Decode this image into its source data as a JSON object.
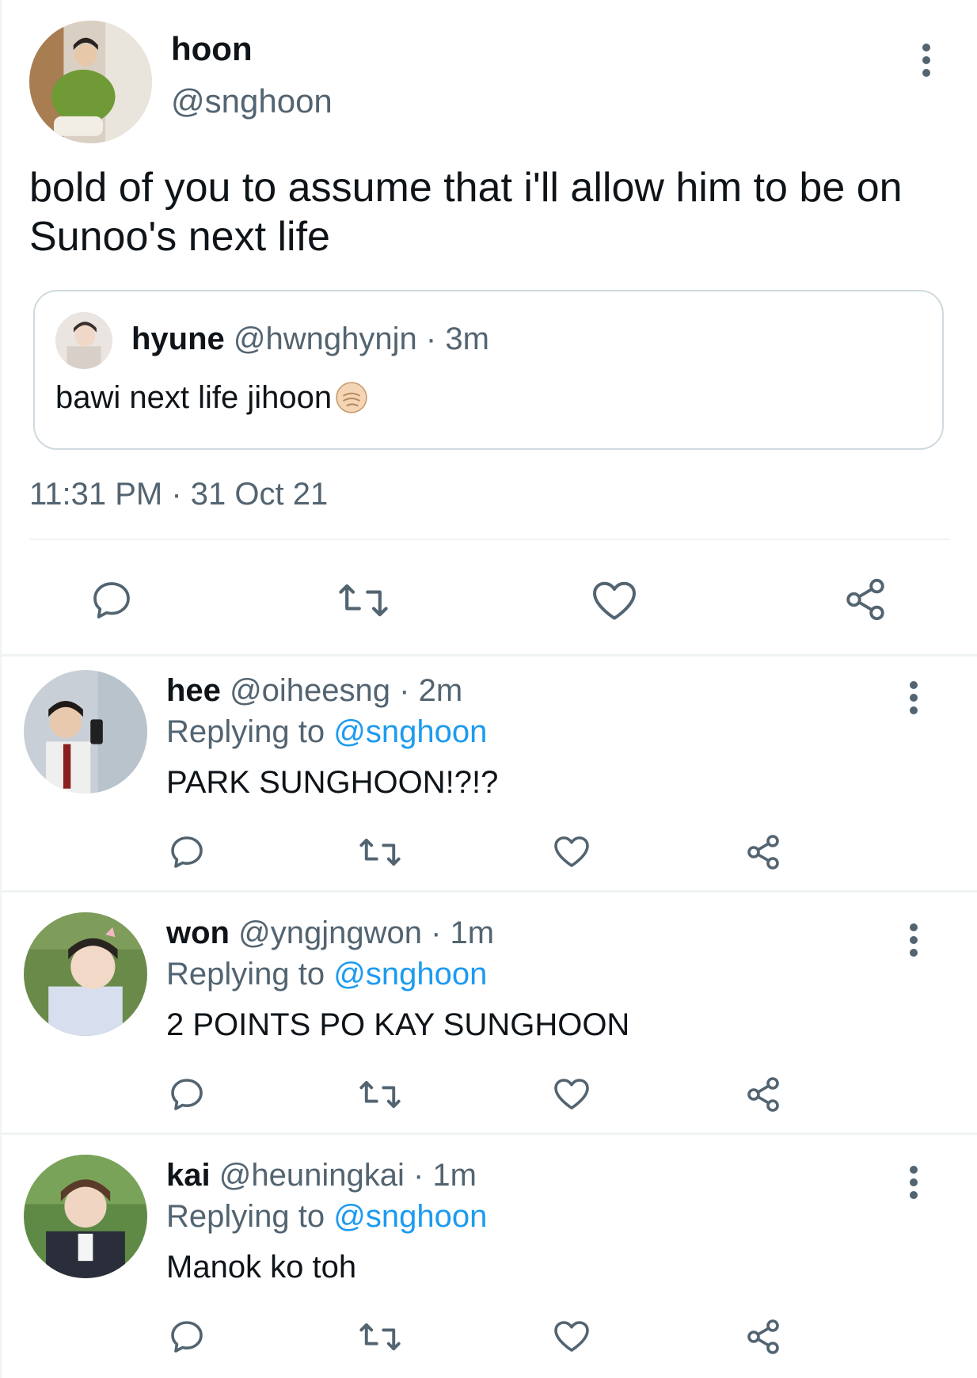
{
  "main_tweet": {
    "author_name": "hoon",
    "author_handle": "@snghoon",
    "text": "bold of you to assume that i'll allow him to be on Sunoo's next life",
    "timestamp": "11:31 PM · 31 Oct 21",
    "more_icon": "more-vertical-icon",
    "quoted_tweet": {
      "author_name": "hyune",
      "author_handle": "@hwnghynjn",
      "separator": " · ",
      "time": "3m",
      "text": "bawi next life jihoon",
      "emoji": "raised-fist-emoji"
    },
    "actions": [
      "reply-icon",
      "retweet-icon",
      "like-icon",
      "share-icon"
    ]
  },
  "replies": [
    {
      "author_name": "hee",
      "author_handle": "@oiheesng",
      "separator": " · ",
      "time": "2m",
      "replying_prefix": "Replying to ",
      "replying_to": "@snghoon",
      "text": "PARK SUNGHOON!?!?"
    },
    {
      "author_name": "won",
      "author_handle": "@yngjngwon",
      "separator": " · ",
      "time": "1m",
      "replying_prefix": "Replying to ",
      "replying_to": "@snghoon",
      "text": "2 POINTS PO KAY SUNGHOON"
    },
    {
      "author_name": "kai",
      "author_handle": "@heuningkai",
      "separator": " · ",
      "time": "1m",
      "replying_prefix": "Replying to ",
      "replying_to": "@snghoon",
      "text": "Manok ko toh"
    }
  ],
  "colors": {
    "text_primary": "#0f1419",
    "text_secondary": "#536471",
    "link": "#1d9bf0",
    "border": "#cfd9de",
    "divider": "#eff3f4"
  }
}
